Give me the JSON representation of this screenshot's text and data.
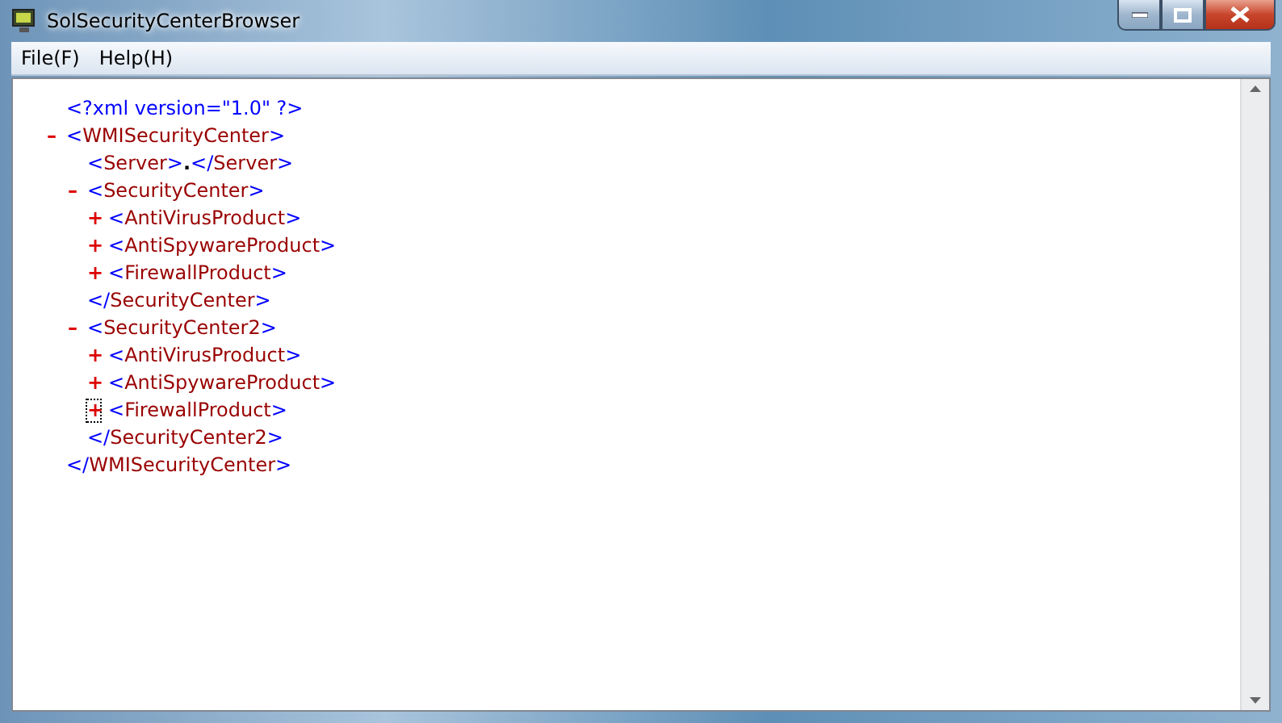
{
  "window": {
    "title": "SolSecurityCenterBrowser"
  },
  "menu": [
    {
      "label": "File(F)"
    },
    {
      "label": "Help(H)"
    }
  ],
  "document": {
    "declaration": "<?xml version=\"1.0\" ?>",
    "tree": [
      {
        "kind": "element",
        "toggle": "–",
        "tag": "<WMISecurityCenter>",
        "focused": false,
        "close": "</WMISecurityCenter>",
        "children": [
          {
            "kind": "leaf",
            "open": "<Server>",
            "text": ".",
            "close": "</Server>"
          },
          {
            "kind": "element",
            "toggle": "–",
            "tag": "<SecurityCenter>",
            "focused": false,
            "close": "</SecurityCenter>",
            "children": [
              {
                "kind": "element",
                "toggle": "+",
                "tag": "<AntiVirusProduct>",
                "focused": false
              },
              {
                "kind": "element",
                "toggle": "+",
                "tag": "<AntiSpywareProduct>",
                "focused": false
              },
              {
                "kind": "element",
                "toggle": "+",
                "tag": "<FirewallProduct>",
                "focused": false
              }
            ]
          },
          {
            "kind": "element",
            "toggle": "–",
            "tag": "<SecurityCenter2>",
            "focused": false,
            "close": "</SecurityCenter2>",
            "children": [
              {
                "kind": "element",
                "toggle": "+",
                "tag": "<AntiVirusProduct>",
                "focused": false
              },
              {
                "kind": "element",
                "toggle": "+",
                "tag": "<AntiSpywareProduct>",
                "focused": false
              },
              {
                "kind": "element",
                "toggle": "+",
                "tag": "<FirewallProduct>",
                "focused": true
              }
            ]
          }
        ]
      }
    ]
  }
}
